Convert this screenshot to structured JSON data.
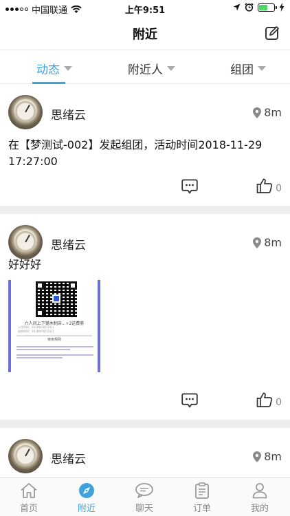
{
  "status_bar": {
    "carrier": "中国联通",
    "time": "上午9:51",
    "battery_percent": 55
  },
  "nav": {
    "title": "附近",
    "edit_icon": "edit-icon"
  },
  "tabs": [
    {
      "label": "动态",
      "active": true
    },
    {
      "label": "附近人",
      "active": false
    },
    {
      "label": "组团",
      "active": false
    }
  ],
  "posts": [
    {
      "username": "思绪云",
      "distance": "8m",
      "content": "在【梦测试-002】发起组团，活动时间2018-11-29 17:27:00",
      "likes": "0"
    },
    {
      "username": "思绪云",
      "distance": "8m",
      "content": "好好好",
      "likes": "0",
      "image": {
        "title": "六人间上下铺木制床...+2送费券",
        "line1": "入住时间：2018年08月10日",
        "line2": "退房时间：2018年08月23日",
        "rules_heading": "使用规则"
      }
    },
    {
      "username": "思绪云",
      "distance": "8m"
    }
  ],
  "tabbar": [
    {
      "label": "首页",
      "icon": "home-icon",
      "active": false
    },
    {
      "label": "附近",
      "icon": "compass-icon",
      "active": true
    },
    {
      "label": "聊天",
      "icon": "chat-icon",
      "active": false
    },
    {
      "label": "订单",
      "icon": "clipboard-icon",
      "active": false
    },
    {
      "label": "我的",
      "icon": "person-icon",
      "active": false
    }
  ],
  "colors": {
    "accent": "#3ea3dc",
    "battery": "#4cd964",
    "ticket_border": "#6f6fd8"
  }
}
